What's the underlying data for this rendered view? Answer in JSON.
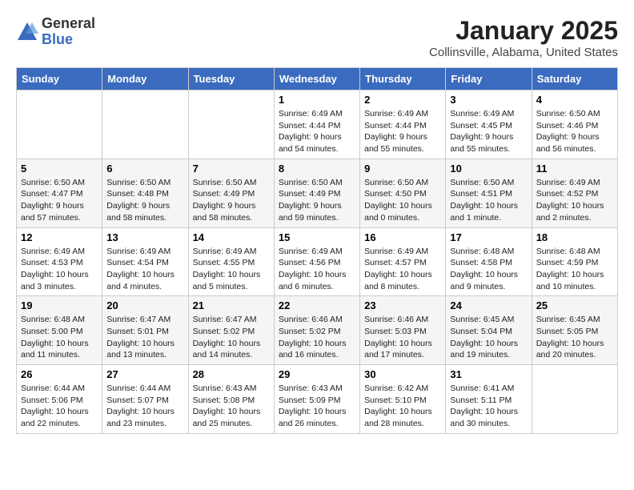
{
  "header": {
    "logo_general": "General",
    "logo_blue": "Blue",
    "title": "January 2025",
    "subtitle": "Collinsville, Alabama, United States"
  },
  "weekdays": [
    "Sunday",
    "Monday",
    "Tuesday",
    "Wednesday",
    "Thursday",
    "Friday",
    "Saturday"
  ],
  "weeks": [
    [
      {
        "day": "",
        "info": ""
      },
      {
        "day": "",
        "info": ""
      },
      {
        "day": "",
        "info": ""
      },
      {
        "day": "1",
        "info": "Sunrise: 6:49 AM\nSunset: 4:44 PM\nDaylight: 9 hours\nand 54 minutes."
      },
      {
        "day": "2",
        "info": "Sunrise: 6:49 AM\nSunset: 4:44 PM\nDaylight: 9 hours\nand 55 minutes."
      },
      {
        "day": "3",
        "info": "Sunrise: 6:49 AM\nSunset: 4:45 PM\nDaylight: 9 hours\nand 55 minutes."
      },
      {
        "day": "4",
        "info": "Sunrise: 6:50 AM\nSunset: 4:46 PM\nDaylight: 9 hours\nand 56 minutes."
      }
    ],
    [
      {
        "day": "5",
        "info": "Sunrise: 6:50 AM\nSunset: 4:47 PM\nDaylight: 9 hours\nand 57 minutes."
      },
      {
        "day": "6",
        "info": "Sunrise: 6:50 AM\nSunset: 4:48 PM\nDaylight: 9 hours\nand 58 minutes."
      },
      {
        "day": "7",
        "info": "Sunrise: 6:50 AM\nSunset: 4:49 PM\nDaylight: 9 hours\nand 58 minutes."
      },
      {
        "day": "8",
        "info": "Sunrise: 6:50 AM\nSunset: 4:49 PM\nDaylight: 9 hours\nand 59 minutes."
      },
      {
        "day": "9",
        "info": "Sunrise: 6:50 AM\nSunset: 4:50 PM\nDaylight: 10 hours\nand 0 minutes."
      },
      {
        "day": "10",
        "info": "Sunrise: 6:50 AM\nSunset: 4:51 PM\nDaylight: 10 hours\nand 1 minute."
      },
      {
        "day": "11",
        "info": "Sunrise: 6:49 AM\nSunset: 4:52 PM\nDaylight: 10 hours\nand 2 minutes."
      }
    ],
    [
      {
        "day": "12",
        "info": "Sunrise: 6:49 AM\nSunset: 4:53 PM\nDaylight: 10 hours\nand 3 minutes."
      },
      {
        "day": "13",
        "info": "Sunrise: 6:49 AM\nSunset: 4:54 PM\nDaylight: 10 hours\nand 4 minutes."
      },
      {
        "day": "14",
        "info": "Sunrise: 6:49 AM\nSunset: 4:55 PM\nDaylight: 10 hours\nand 5 minutes."
      },
      {
        "day": "15",
        "info": "Sunrise: 6:49 AM\nSunset: 4:56 PM\nDaylight: 10 hours\nand 6 minutes."
      },
      {
        "day": "16",
        "info": "Sunrise: 6:49 AM\nSunset: 4:57 PM\nDaylight: 10 hours\nand 8 minutes."
      },
      {
        "day": "17",
        "info": "Sunrise: 6:48 AM\nSunset: 4:58 PM\nDaylight: 10 hours\nand 9 minutes."
      },
      {
        "day": "18",
        "info": "Sunrise: 6:48 AM\nSunset: 4:59 PM\nDaylight: 10 hours\nand 10 minutes."
      }
    ],
    [
      {
        "day": "19",
        "info": "Sunrise: 6:48 AM\nSunset: 5:00 PM\nDaylight: 10 hours\nand 11 minutes."
      },
      {
        "day": "20",
        "info": "Sunrise: 6:47 AM\nSunset: 5:01 PM\nDaylight: 10 hours\nand 13 minutes."
      },
      {
        "day": "21",
        "info": "Sunrise: 6:47 AM\nSunset: 5:02 PM\nDaylight: 10 hours\nand 14 minutes."
      },
      {
        "day": "22",
        "info": "Sunrise: 6:46 AM\nSunset: 5:02 PM\nDaylight: 10 hours\nand 16 minutes."
      },
      {
        "day": "23",
        "info": "Sunrise: 6:46 AM\nSunset: 5:03 PM\nDaylight: 10 hours\nand 17 minutes."
      },
      {
        "day": "24",
        "info": "Sunrise: 6:45 AM\nSunset: 5:04 PM\nDaylight: 10 hours\nand 19 minutes."
      },
      {
        "day": "25",
        "info": "Sunrise: 6:45 AM\nSunset: 5:05 PM\nDaylight: 10 hours\nand 20 minutes."
      }
    ],
    [
      {
        "day": "26",
        "info": "Sunrise: 6:44 AM\nSunset: 5:06 PM\nDaylight: 10 hours\nand 22 minutes."
      },
      {
        "day": "27",
        "info": "Sunrise: 6:44 AM\nSunset: 5:07 PM\nDaylight: 10 hours\nand 23 minutes."
      },
      {
        "day": "28",
        "info": "Sunrise: 6:43 AM\nSunset: 5:08 PM\nDaylight: 10 hours\nand 25 minutes."
      },
      {
        "day": "29",
        "info": "Sunrise: 6:43 AM\nSunset: 5:09 PM\nDaylight: 10 hours\nand 26 minutes."
      },
      {
        "day": "30",
        "info": "Sunrise: 6:42 AM\nSunset: 5:10 PM\nDaylight: 10 hours\nand 28 minutes."
      },
      {
        "day": "31",
        "info": "Sunrise: 6:41 AM\nSunset: 5:11 PM\nDaylight: 10 hours\nand 30 minutes."
      },
      {
        "day": "",
        "info": ""
      }
    ]
  ]
}
